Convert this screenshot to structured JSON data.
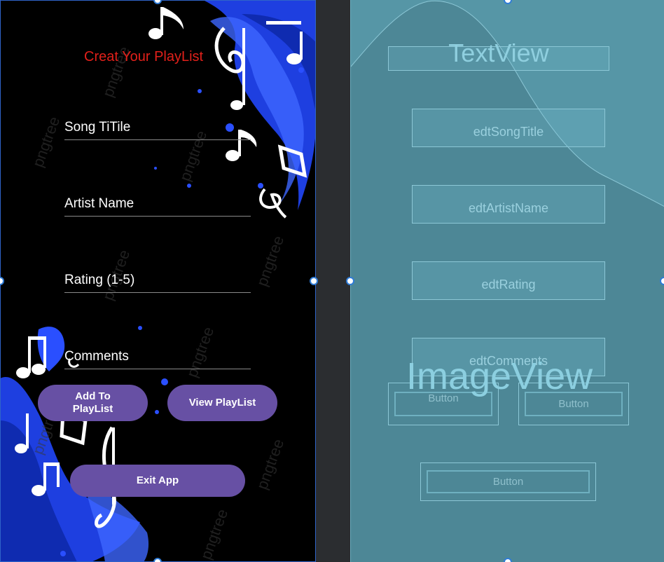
{
  "design": {
    "title": "Creat Your PlayList",
    "fields": {
      "song_title": "Song TiTile",
      "artist_name": "Artist Name",
      "rating": "Rating (1-5)",
      "comments": "Comments"
    },
    "buttons": {
      "add": "Add To PlayList",
      "view": "View PlayList",
      "exit": "Exit App"
    },
    "colors": {
      "title": "#e2201a",
      "button": "#6750a4",
      "splash": "#1e3fe0",
      "background": "#000000"
    },
    "watermark": "pngtree"
  },
  "blueprint": {
    "text_view": "TextView",
    "edt_song_title": "edtSongTitle",
    "edt_artist_name": "edtArtistName",
    "edt_rating": "edtRating",
    "edt_comments": "edtComments",
    "image_view": "ImageView",
    "button_left": "Button",
    "button_right": "Button",
    "button_bottom": "Button",
    "colors": {
      "background": "#4d8796",
      "outline": "#8cc7d6"
    }
  }
}
